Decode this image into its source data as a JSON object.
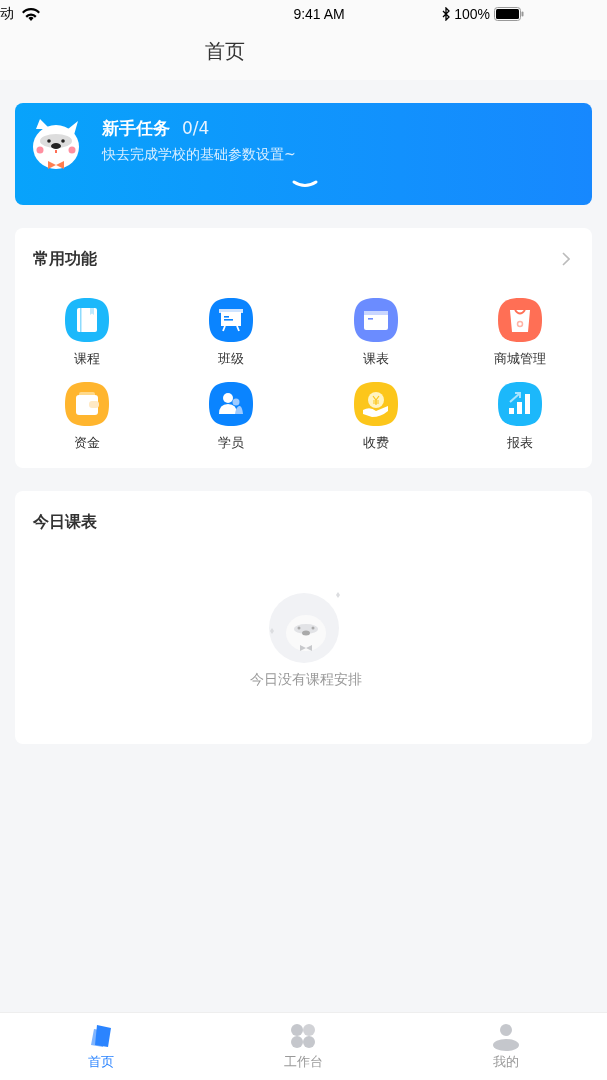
{
  "status_bar": {
    "carrier": "动",
    "time": "9:41 AM",
    "battery": "100%"
  },
  "nav": {
    "title": "首页"
  },
  "task_banner": {
    "title": "新手任务",
    "progress": "0/4",
    "subtitle": "快去完成学校的基础参数设置~"
  },
  "functions": {
    "title": "常用功能",
    "items": [
      {
        "label": "课程",
        "kind": "book",
        "color": "#1cb8fb"
      },
      {
        "label": "班级",
        "kind": "board",
        "color": "#0a84ff"
      },
      {
        "label": "课表",
        "kind": "calendar",
        "color": "#6b8cff"
      },
      {
        "label": "商城管理",
        "kind": "bag",
        "color": "#ff6f55"
      },
      {
        "label": "资金",
        "kind": "wallet",
        "color": "#ffb52e"
      },
      {
        "label": "学员",
        "kind": "people",
        "color": "#0a84ff"
      },
      {
        "label": "收费",
        "kind": "coin",
        "color": "#fcc61b"
      },
      {
        "label": "报表",
        "kind": "chart",
        "color": "#1cb8fb"
      }
    ]
  },
  "schedule": {
    "title": "今日课表",
    "empty_text": "今日没有课程安排"
  },
  "tab_bar": [
    {
      "label": "首页",
      "kind": "home",
      "selected": true
    },
    {
      "label": "工作台",
      "kind": "grid",
      "selected": false
    },
    {
      "label": "我的",
      "kind": "person",
      "selected": false
    }
  ]
}
